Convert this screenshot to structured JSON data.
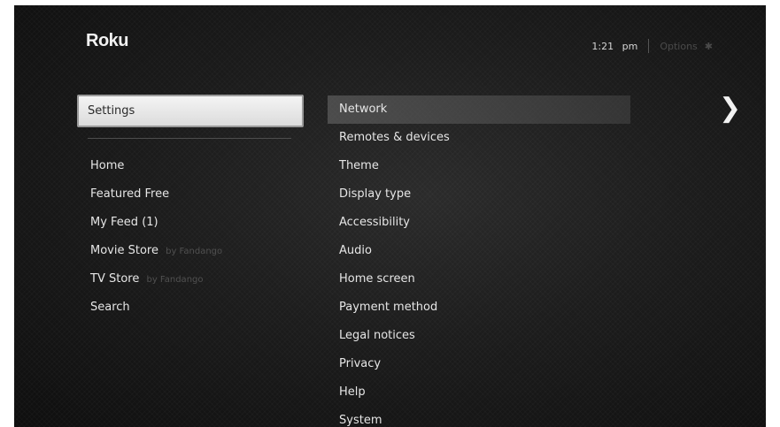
{
  "header": {
    "logo": "Roku",
    "time": "1:21",
    "ampm": "pm",
    "options_label": "Options",
    "options_icon": "asterisk-icon"
  },
  "left_menu": {
    "selected": "Settings",
    "items": [
      {
        "label": "Home",
        "byline": ""
      },
      {
        "label": "Featured Free",
        "byline": ""
      },
      {
        "label": "My Feed (1)",
        "byline": ""
      },
      {
        "label": "Movie Store",
        "byline": "by Fandango"
      },
      {
        "label": "TV Store",
        "byline": "by Fandango"
      },
      {
        "label": "Search",
        "byline": ""
      }
    ]
  },
  "settings_menu": {
    "items": [
      "Network",
      "Remotes & devices",
      "Theme",
      "Display type",
      "Accessibility",
      "Audio",
      "Home screen",
      "Payment method",
      "Legal notices",
      "Privacy",
      "Help",
      "System"
    ],
    "highlighted_index": 0
  },
  "nav": {
    "next_icon": "chevron-right-icon"
  }
}
